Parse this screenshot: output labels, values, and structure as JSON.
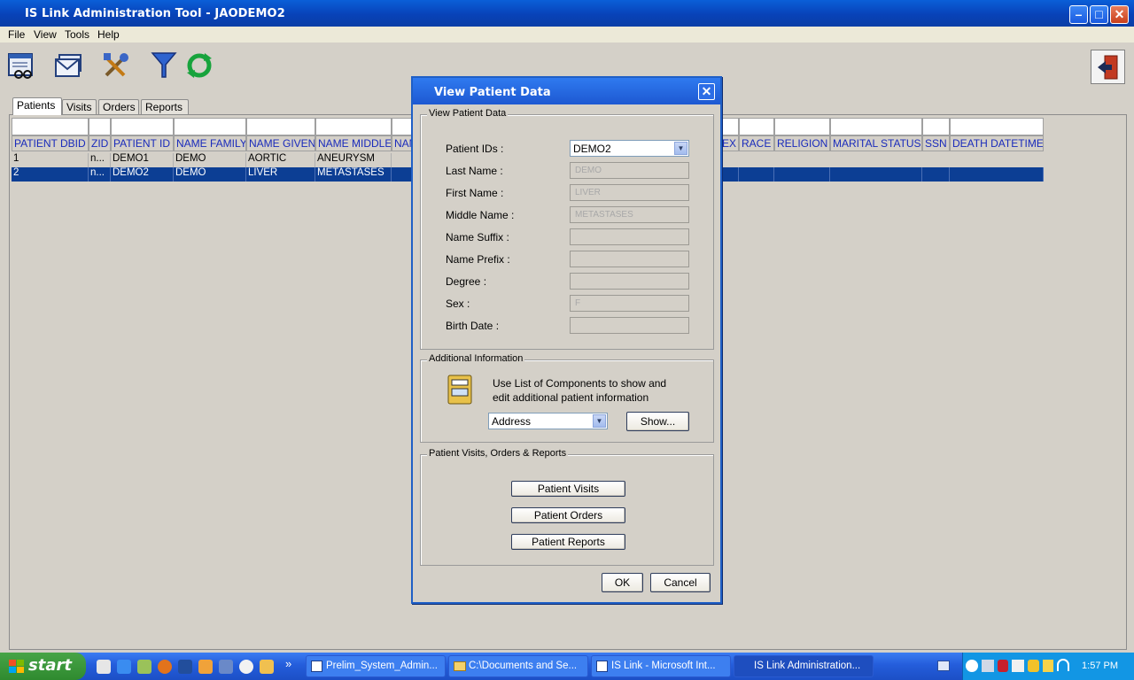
{
  "window": {
    "title": "IS Link Administration Tool - JAODEMO2"
  },
  "menu": [
    "File",
    "View",
    "Tools",
    "Help"
  ],
  "toolbar": {
    "icons": [
      "patient-list-icon",
      "mail-icon",
      "tools-icon",
      "filter-icon",
      "refresh-icon",
      "exit-icon"
    ]
  },
  "tabs": [
    "Patients",
    "Visits",
    "Orders",
    "Reports"
  ],
  "grid": {
    "columns": [
      "PATIENT DBID",
      "ZID",
      "PATIENT ID",
      "NAME FAMILY",
      "NAME GIVEN",
      "NAME MIDDLE",
      "NAM",
      "EX",
      "RACE",
      "RELIGION",
      "MARITAL STATUS",
      "SSN",
      "DEATH DATETIME"
    ],
    "rows": [
      [
        "1",
        "n...",
        "DEMO1",
        "DEMO",
        "AORTIC",
        "ANEURYSM"
      ],
      [
        "2",
        "n...",
        "DEMO2",
        "DEMO",
        "LIVER",
        "METASTASES"
      ]
    ],
    "selected_row": 2
  },
  "dialog": {
    "title": "View Patient Data",
    "section1": "View Patient Data",
    "labels": [
      "Patient IDs :",
      "Last Name :",
      "First Name :",
      "Middle Name :",
      "Name Suffix :",
      "Name Prefix :",
      "Degree :",
      "Sex :",
      "Birth Date :"
    ],
    "patient_ids_value": "DEMO2",
    "values": [
      "DEMO",
      "LIVER",
      "METASTASES",
      "",
      "",
      "",
      "F",
      ""
    ],
    "section2": "Additional Information",
    "info_text_1": "Use List of Components to show and",
    "info_text_2": "edit additional patient information",
    "component_select": "Address",
    "show_label": "Show...",
    "section3": "Patient Visits, Orders & Reports",
    "visits_label": "Patient Visits",
    "orders_label": "Patient Orders",
    "reports_label": "Patient Reports",
    "ok_label": "OK",
    "cancel_label": "Cancel"
  },
  "taskbar": {
    "start_label": "start",
    "chevron": "»",
    "tasks": [
      "Prelim_System_Admin...",
      "C:\\Documents and Se...",
      "IS Link - Microsoft Int...",
      "IS Link Administration..."
    ],
    "clock": "1:57 PM"
  }
}
